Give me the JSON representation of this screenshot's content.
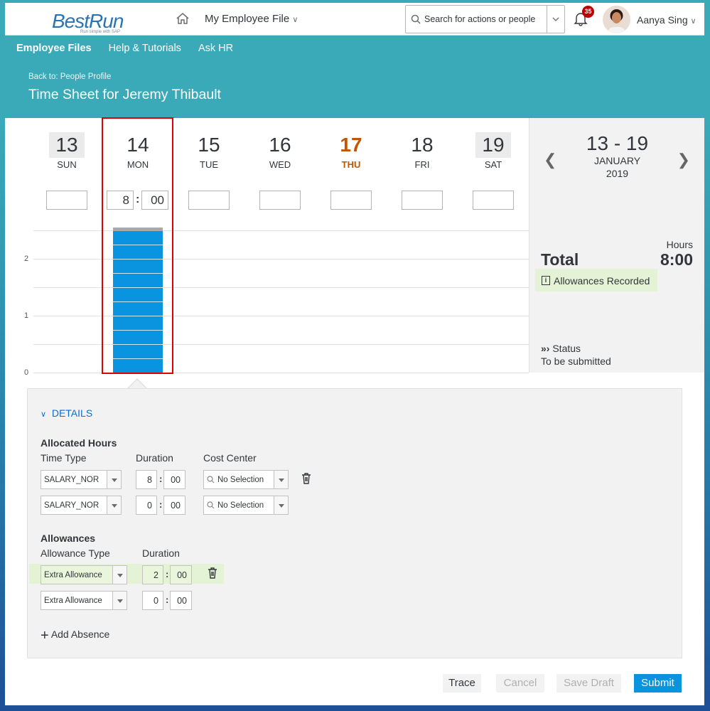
{
  "header": {
    "logo": "BestRun",
    "logo_tag": "Run simple with SAP",
    "app_menu": "My Employee File",
    "search_placeholder": "Search for actions or people",
    "notif_count": "35",
    "user_name": "Aanya Sing"
  },
  "nav": {
    "items": [
      "Employee Files",
      "Help & Tutorials",
      "Ask HR"
    ]
  },
  "page": {
    "back_link": "Back to: People Profile",
    "title": "Time Sheet for Jeremy Thibault"
  },
  "week": {
    "days": [
      {
        "num": "13",
        "name": "SUN"
      },
      {
        "num": "14",
        "name": "MON"
      },
      {
        "num": "15",
        "name": "TUE"
      },
      {
        "num": "16",
        "name": "WED"
      },
      {
        "num": "17",
        "name": "THU"
      },
      {
        "num": "18",
        "name": "FRI"
      },
      {
        "num": "19",
        "name": "SAT"
      }
    ],
    "mon_hours": "8",
    "mon_minutes": "00",
    "y_ticks": [
      "2",
      "1",
      "0"
    ]
  },
  "chart_data": {
    "type": "bar",
    "categories": [
      "SUN",
      "MON",
      "TUE",
      "WED",
      "THU",
      "FRI",
      "SAT"
    ],
    "values": [
      0,
      8,
      0,
      0,
      0,
      0,
      0
    ],
    "ylim": [
      0,
      2.5
    ]
  },
  "summary": {
    "range": "13 - 19",
    "month": "JANUARY",
    "year": "2019",
    "hours_label": "Hours",
    "total_label": "Total",
    "total_value": "8:00",
    "allowances_badge": "Allowances Recorded",
    "status_label": "Status",
    "status_value": "To be submitted"
  },
  "details": {
    "toggle": "DETAILS",
    "allocated_title": "Allocated Hours",
    "col_time_type": "Time Type",
    "col_duration": "Duration",
    "col_cost_center": "Cost Center",
    "rows": [
      {
        "type": "SALARY_NOR",
        "h": "8",
        "m": "00",
        "cc": "No Selection"
      },
      {
        "type": "SALARY_NOR",
        "h": "0",
        "m": "00",
        "cc": "No Selection"
      }
    ],
    "allowances_title": "Allowances",
    "col_allowance_type": "Allowance Type",
    "col_allow_duration": "Duration",
    "allow_rows": [
      {
        "type": "Extra Allowance",
        "h": "2",
        "m": "00"
      },
      {
        "type": "Extra Allowance",
        "h": "0",
        "m": "00"
      }
    ],
    "add_absence": "Add Absence"
  },
  "footer": {
    "trace": "Trace",
    "cancel": "Cancel",
    "save_draft": "Save Draft",
    "submit": "Submit"
  },
  "colors": {
    "accent": "#0a6ed1",
    "bar": "#0a93de",
    "today": "#c35500",
    "highlight": "#e4f2d5",
    "selection": "#e00000"
  }
}
